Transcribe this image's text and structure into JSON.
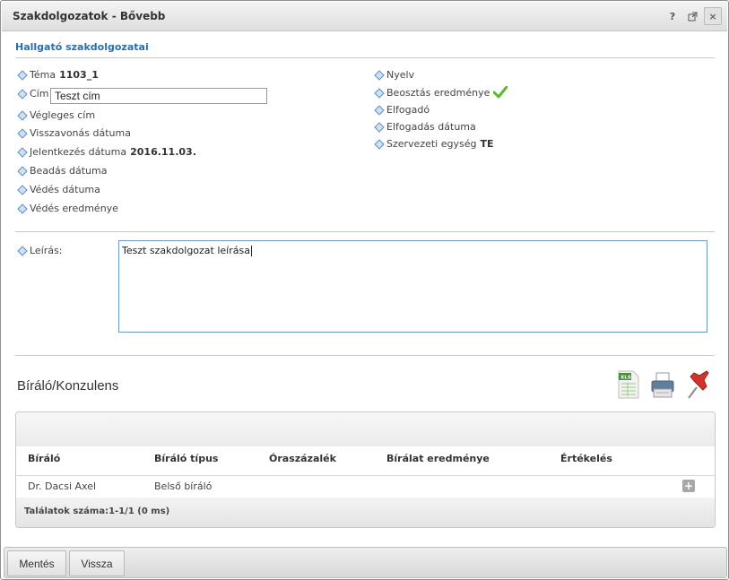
{
  "window": {
    "title": "Szakdolgozatok - Bővebb",
    "help_label": "?",
    "popout_label": "⇱",
    "close_label": "×"
  },
  "section_title": "Hallgató szakdolgozatai",
  "left_fields": [
    {
      "label": "Téma",
      "value": "1103_1"
    },
    {
      "label": "Cím",
      "value": ""
    },
    {
      "label": "Végleges cím",
      "value": ""
    },
    {
      "label": "Visszavonás dátuma",
      "value": ""
    },
    {
      "label": "Jelentkezés dátuma",
      "value": "2016.11.03."
    },
    {
      "label": "Beadás dátuma",
      "value": ""
    },
    {
      "label": "Védés dátuma",
      "value": ""
    },
    {
      "label": "Védés eredménye",
      "value": ""
    }
  ],
  "cim_input_value": "Teszt cím",
  "right_fields": [
    {
      "label": "Nyelv",
      "value": ""
    },
    {
      "label": "Beosztás eredménye",
      "value": ""
    },
    {
      "label": "Elfogadó",
      "value": ""
    },
    {
      "label": "Elfogadás dátuma",
      "value": ""
    },
    {
      "label": "Szervezeti egység",
      "value": "TE"
    }
  ],
  "leiras": {
    "label": "Leírás:",
    "value": "Teszt szakdolgozat leírása"
  },
  "reviewers": {
    "title": "Bíráló/Konzulens",
    "icons": [
      "excel-export-icon",
      "print-icon",
      "pin-icon"
    ],
    "columns": [
      "Bíráló",
      "Bíráló típus",
      "Óraszázalék",
      "Bírálat eredménye",
      "Értékelés"
    ],
    "rows": [
      {
        "biralo": "Dr. Dacsi Axel",
        "tipus": "Belső bíráló",
        "oraszazalek": "",
        "eredmeny": "",
        "ertekeles": ""
      }
    ],
    "footer": "Találatok száma:1-1/1 (0 ms)"
  },
  "buttons": {
    "save": "Mentés",
    "back": "Vissza"
  },
  "colors": {
    "accent": "#2a6fa8",
    "check": "#5cb82e"
  }
}
